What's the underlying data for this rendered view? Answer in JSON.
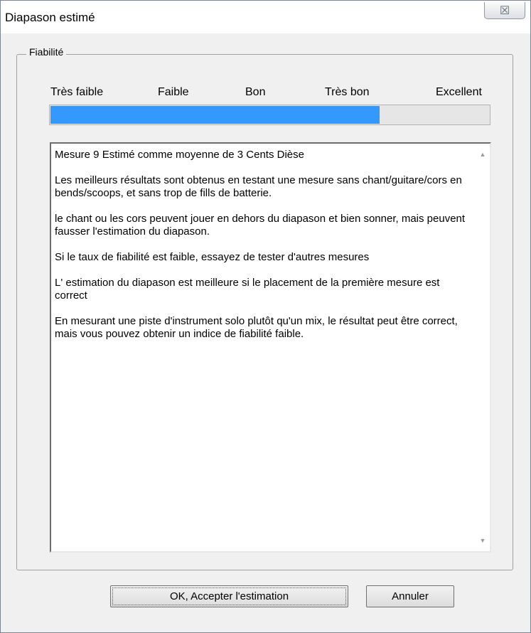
{
  "window": {
    "title": "Diapason estimé",
    "close_glyph": "☒"
  },
  "reliability": {
    "group_label": "Fiabilité",
    "scale_labels": [
      "Très faible",
      "Faible",
      "Bon",
      "Très bon",
      "Excellent"
    ],
    "level_fraction": 0.75,
    "fill_color": "#3399ff"
  },
  "message": {
    "paragraphs": [
      "Mesure 9 Estimé comme moyenne de 3 Cents Dièse",
      "Les meilleurs résultats sont obtenus en testant une mesure sans chant/guitare/cors en bends/scoops, et sans trop de fills de batterie.",
      "le chant ou les cors peuvent jouer en dehors du diapason et bien sonner, mais peuvent fausser l'estimation du diapason.",
      "Si le taux de fiabilité est faible, essayez de tester d'autres mesures",
      "L' estimation du diapason est meilleure si le placement de la première mesure est correct",
      "En mesurant une piste d'instrument solo plutôt qu'un mix, le résultat peut être correct, mais vous pouvez obtenir un indice de fiabilité faible."
    ]
  },
  "buttons": {
    "ok_label": "OK, Accepter l'estimation",
    "cancel_label": "Annuler"
  }
}
